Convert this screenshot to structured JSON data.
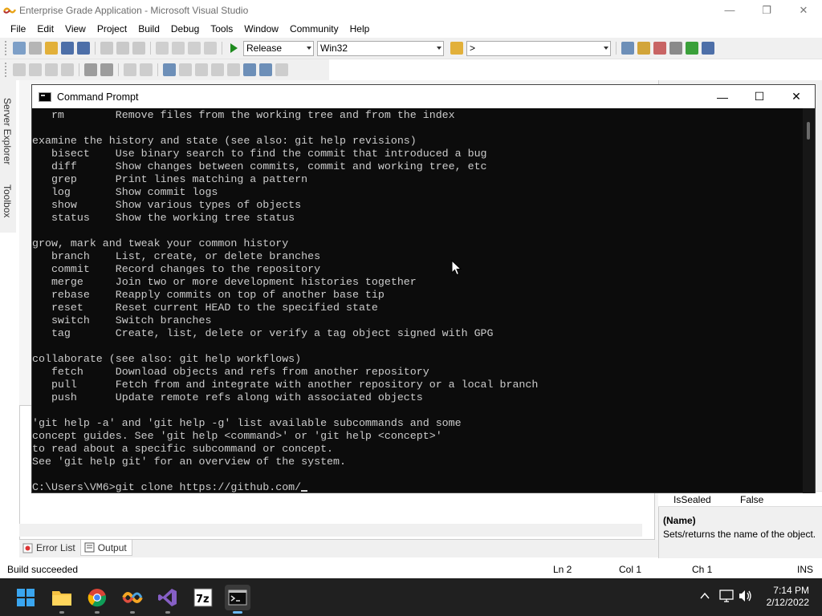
{
  "vs": {
    "title": "Enterprise Grade Application - Microsoft Visual Studio",
    "menu": [
      "File",
      "Edit",
      "View",
      "Project",
      "Build",
      "Debug",
      "Tools",
      "Window",
      "Community",
      "Help"
    ],
    "toolbar": {
      "config": "Release",
      "platform": "Win32",
      "find": ">"
    },
    "side_tabs": [
      "Server Explorer",
      "Toolbox"
    ],
    "output_tabs": [
      "Error List",
      "Output"
    ],
    "properties": {
      "row": {
        "name": "IsSealed",
        "value": "False"
      },
      "desc_name": "(Name)",
      "desc_text": "Sets/returns the name of the object."
    },
    "status": {
      "message": "Build succeeded",
      "ln": "Ln 2",
      "col": "Col 1",
      "ch": "Ch 1",
      "mode": "INS"
    }
  },
  "cmd": {
    "title": "Command Prompt",
    "lines": [
      "   rm        Remove files from the working tree and from the index",
      "",
      "examine the history and state (see also: git help revisions)",
      "   bisect    Use binary search to find the commit that introduced a bug",
      "   diff      Show changes between commits, commit and working tree, etc",
      "   grep      Print lines matching a pattern",
      "   log       Show commit logs",
      "   show      Show various types of objects",
      "   status    Show the working tree status",
      "",
      "grow, mark and tweak your common history",
      "   branch    List, create, or delete branches",
      "   commit    Record changes to the repository",
      "   merge     Join two or more development histories together",
      "   rebase    Reapply commits on top of another base tip",
      "   reset     Reset current HEAD to the specified state",
      "   switch    Switch branches",
      "   tag       Create, list, delete or verify a tag object signed with GPG",
      "",
      "collaborate (see also: git help workflows)",
      "   fetch     Download objects and refs from another repository",
      "   pull      Fetch from and integrate with another repository or a local branch",
      "   push      Update remote refs along with associated objects",
      "",
      "'git help -a' and 'git help -g' list available subcommands and some",
      "concept guides. See 'git help <command>' or 'git help <concept>'",
      "to read about a specific subcommand or concept.",
      "See 'git help git' for an overview of the system.",
      ""
    ],
    "prompt": "C:\\Users\\VM6>",
    "input": "git clone https://github.com/"
  },
  "taskbar": {
    "apps": [
      "start-icon",
      "file-explorer-icon",
      "chrome-icon",
      "app-icon",
      "visual-studio-icon",
      "7zip-icon",
      "command-prompt-icon"
    ],
    "time": "7:14 PM",
    "date": "2/12/2022"
  }
}
